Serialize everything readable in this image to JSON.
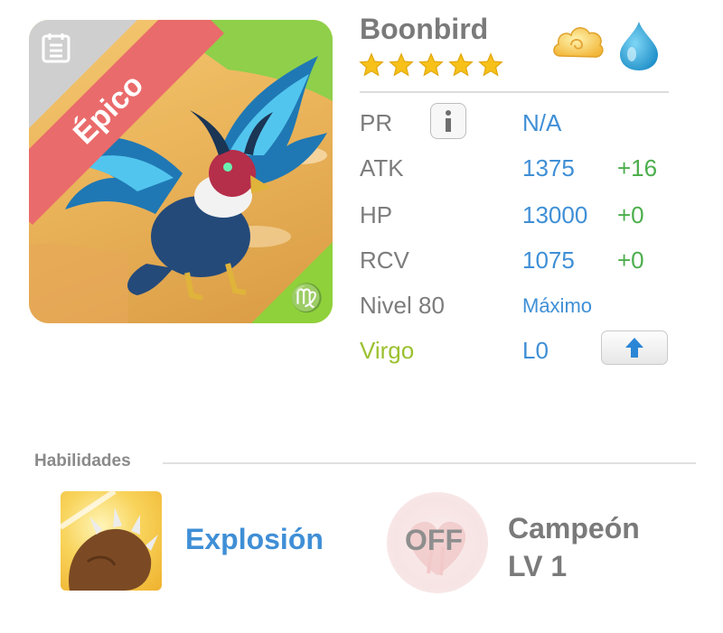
{
  "monster": {
    "name": "Boonbird",
    "rarity": "Épico",
    "stars": 5,
    "zodiac_glyph": "♍",
    "elements": [
      "cloud-icon",
      "water-drop-icon"
    ]
  },
  "stats": {
    "pr": {
      "label": "PR",
      "value": "N/A"
    },
    "atk": {
      "label": "ATK",
      "value": "1375",
      "bonus": "+16"
    },
    "hp": {
      "label": "HP",
      "value": "13000",
      "bonus": "+0"
    },
    "rcv": {
      "label": "RCV",
      "value": "1075",
      "bonus": "+0"
    },
    "level": {
      "label": "Nivel 80",
      "value": "Máximo"
    },
    "sign": {
      "label": "Virgo",
      "value": "L0"
    }
  },
  "skills": {
    "header": "Habilidades",
    "active": {
      "name": "Explosión",
      "icon": "claw-strike-icon"
    },
    "leader": {
      "status": "OFF",
      "name_line1": "Campeón",
      "name_line2": "LV 1",
      "icon": "heart-claw-icon"
    }
  },
  "colors": {
    "accent_blue": "#3f8fd6",
    "bonus_green": "#4cae4c",
    "rarity_red": "#ea6b6b",
    "virgo_green": "#9bc12f"
  }
}
